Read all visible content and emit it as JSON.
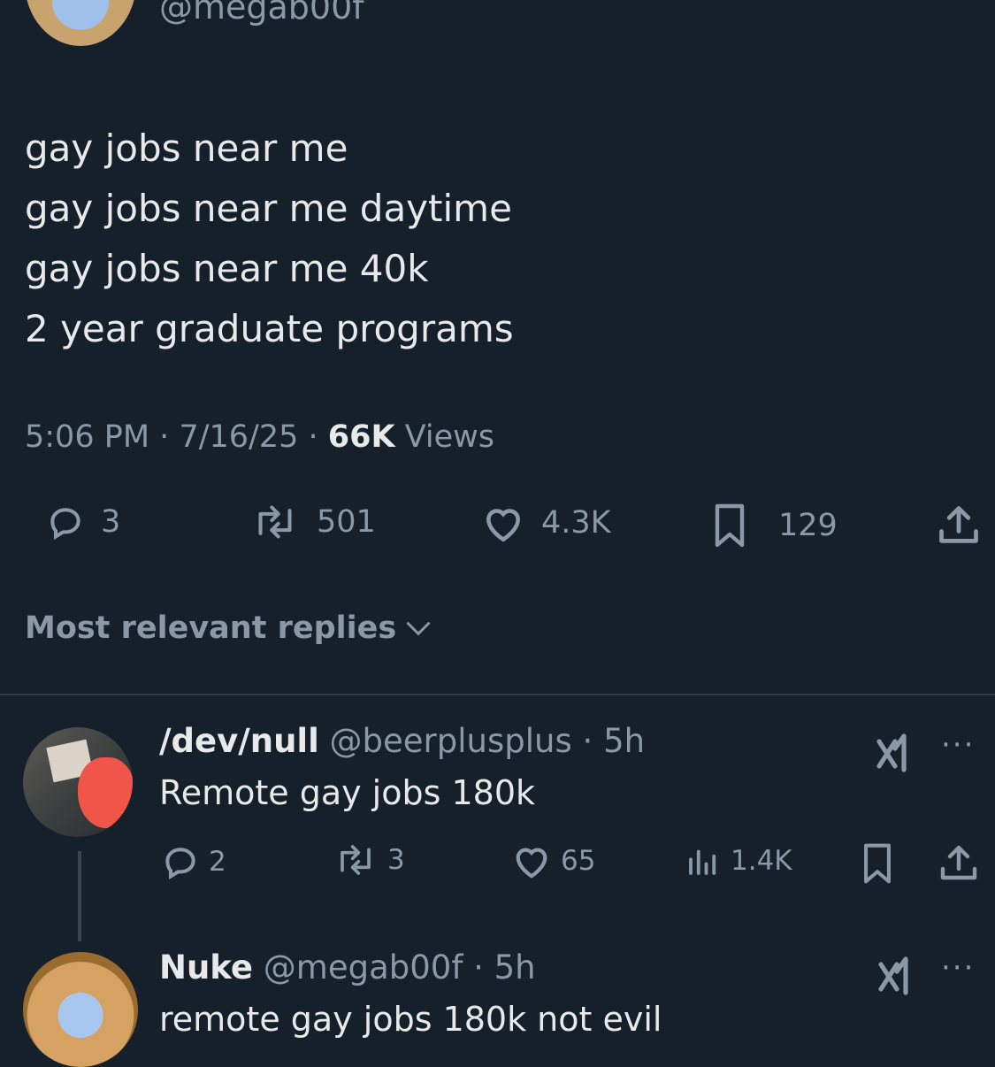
{
  "tweet": {
    "author_handle": "@megab00f",
    "lines": [
      "gay jobs near me",
      "gay jobs near me daytime",
      "gay jobs near me 40k",
      "2 year graduate programs"
    ],
    "time": "5:06 PM",
    "date": "7/16/25",
    "views_count": "66K",
    "views_label": "Views",
    "replies": "3",
    "reposts": "501",
    "likes": "4.3K",
    "bookmarks": "129"
  },
  "replies_sort": {
    "label": "Most relevant replies"
  },
  "replies": [
    {
      "name": "/dev/null",
      "handle": "@beerplusplus",
      "age": "5h",
      "text": "Remote gay jobs 180k",
      "replies": "2",
      "reposts": "3",
      "likes": "65",
      "views": "1.4K"
    },
    {
      "name": "Nuke",
      "handle": "@megab00f",
      "age": "5h",
      "text": "remote gay jobs 180k not evil"
    }
  ],
  "separator": "·",
  "icons": {
    "reply": "reply-icon",
    "repost": "repost-icon",
    "like": "heart-icon",
    "bookmark": "bookmark-icon",
    "share": "share-icon",
    "views": "analytics-icon",
    "grok": "grok-icon",
    "more": "more-icon",
    "chevron": "chevron-down-icon"
  },
  "colors": {
    "background": "#15202b",
    "text": "#e7e9ea",
    "muted": "#8b98a5"
  }
}
